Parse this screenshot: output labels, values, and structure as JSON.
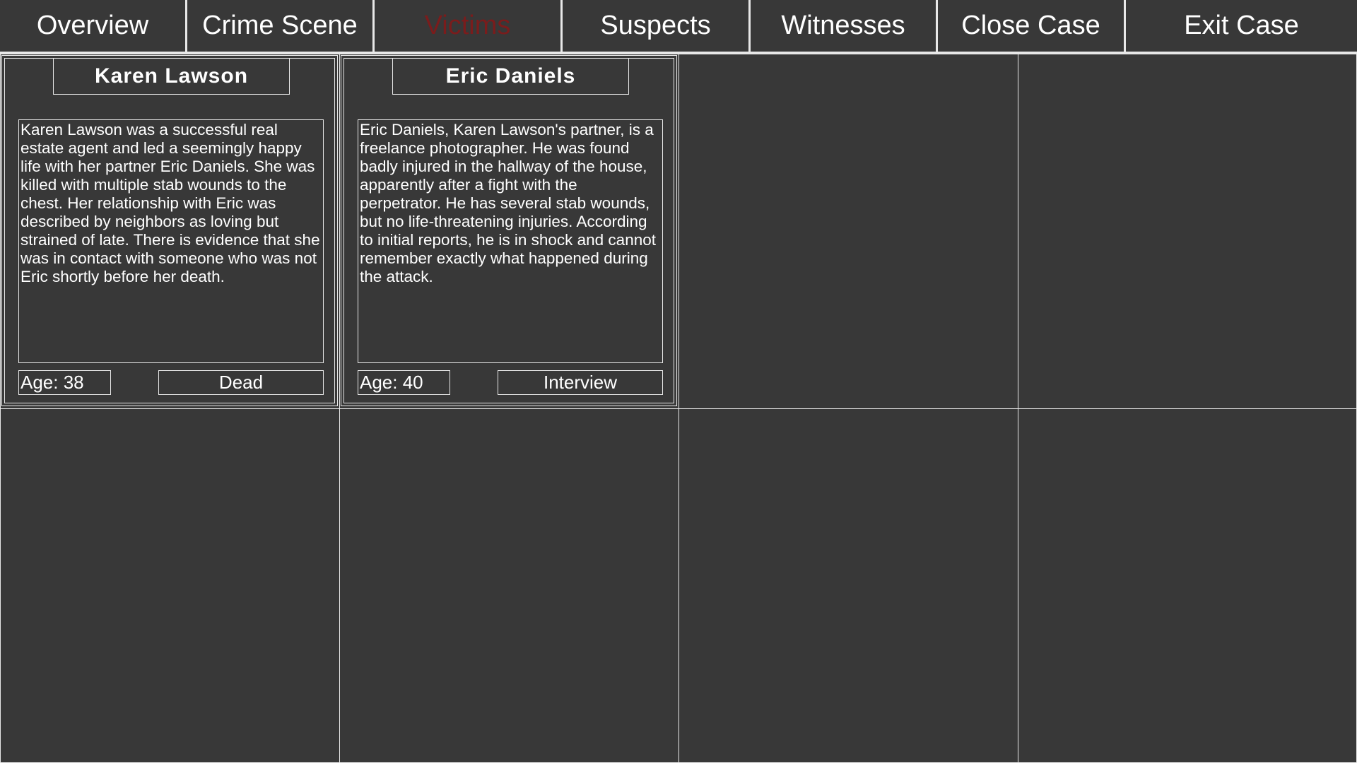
{
  "nav": {
    "tabs": [
      {
        "label": "Overview",
        "active": false
      },
      {
        "label": "Crime Scene",
        "active": false
      },
      {
        "label": "Victims",
        "active": true
      },
      {
        "label": "Suspects",
        "active": false
      },
      {
        "label": "Witnesses",
        "active": false
      },
      {
        "label": "Close Case",
        "active": false
      },
      {
        "label": "Exit Case",
        "active": false
      }
    ],
    "active_color": "#7a1c1c"
  },
  "victims": [
    {
      "name": "Karen Lawson",
      "description": "Karen Lawson was a successful real estate agent and led a seemingly happy life with her partner Eric Daniels. She was killed with multiple stab wounds to the chest. Her relationship with Eric was described by neighbors as loving but strained of late. There is evidence that she was in contact with someone who was not Eric shortly before her death.",
      "age": "Age: 38",
      "status": "Dead"
    },
    {
      "name": "Eric Daniels",
      "description": "Eric Daniels, Karen Lawson's partner, is a freelance photographer. He was found badly injured in the hallway of the house, apparently after a fight with the perpetrator. He has several stab wounds, but no life-threatening injuries. According to initial reports, he is in shock and cannot remember exactly what happened during the attack.",
      "age": "Age: 40",
      "status": "Interview"
    }
  ],
  "colors": {
    "background": "#383838",
    "border": "#e8e8e8",
    "text": "#ffffff"
  }
}
